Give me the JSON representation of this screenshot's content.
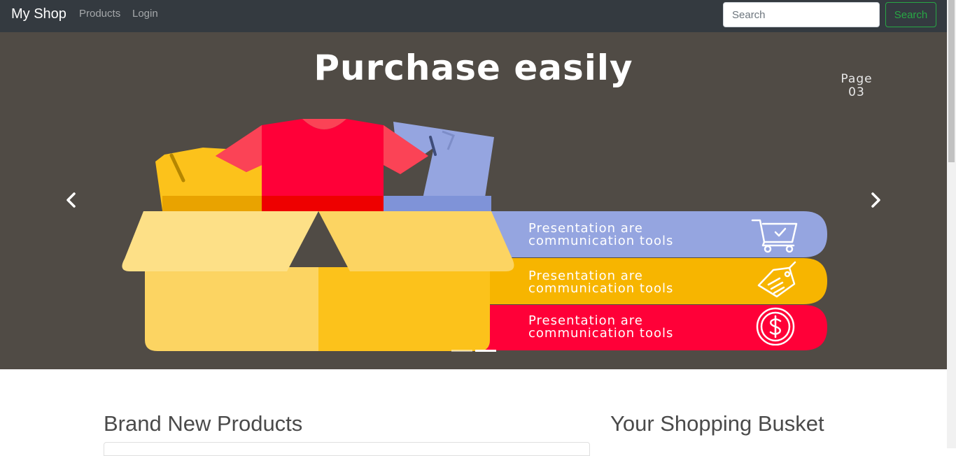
{
  "navbar": {
    "brand": "My Shop",
    "links": [
      "Products",
      "Login"
    ],
    "search_placeholder": "Search",
    "search_button": "Search"
  },
  "carousel": {
    "title": "Purchase easily",
    "page_label_line1": "Page",
    "page_label_line2": "03",
    "bands": [
      {
        "line1": "Presentation are",
        "line2": "communication tools",
        "icon": "shopping-cart-icon",
        "color": "#95a5e0"
      },
      {
        "line1": "Presentation are",
        "line2": "communication tools",
        "icon": "price-tag-icon",
        "color": "#f7b500"
      },
      {
        "line1": "Presentation are",
        "line2": "communication tools",
        "icon": "dollar-coin-icon",
        "color": "#ff0038"
      }
    ],
    "background": "#504b45",
    "active_slide_indicator": 2,
    "indicator_count": 2
  },
  "main": {
    "left_title": "Brand New Products",
    "right_title": "Your Shopping Busket"
  },
  "colors": {
    "navbar": "#343a40",
    "search_button": "#28a745"
  }
}
